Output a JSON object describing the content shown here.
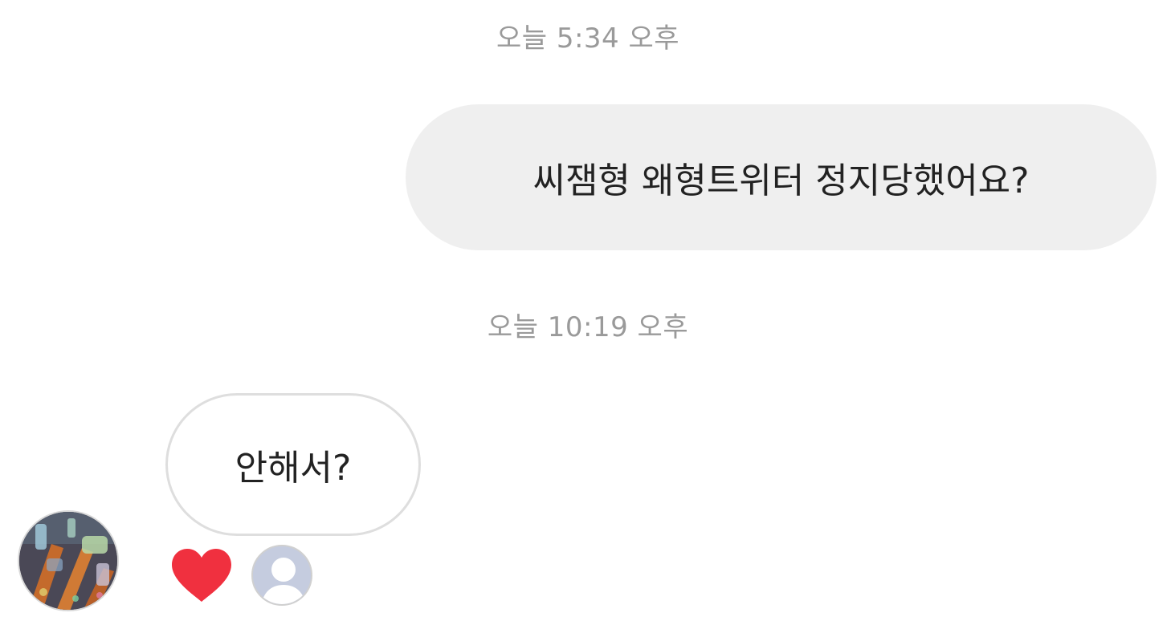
{
  "messages": [
    {
      "type": "timestamp",
      "text": "오늘 5:34 오후"
    },
    {
      "type": "outgoing",
      "text": "씨잼형 왜형트위터 정지당했어요?"
    },
    {
      "type": "timestamp",
      "text": "오늘 10:19 오후"
    },
    {
      "type": "incoming",
      "text": "안해서?",
      "reaction": "heart-icon"
    }
  ],
  "colors": {
    "timestamp": "#9a9a9a",
    "outgoing_bubble": "#efefef",
    "incoming_border": "#dedede",
    "heart": "#f0303f",
    "text": "#222222"
  },
  "icons": {
    "sender_avatar": "sender-avatar",
    "reaction": "heart-icon",
    "reactor_avatar": "default-user-avatar-icon"
  }
}
